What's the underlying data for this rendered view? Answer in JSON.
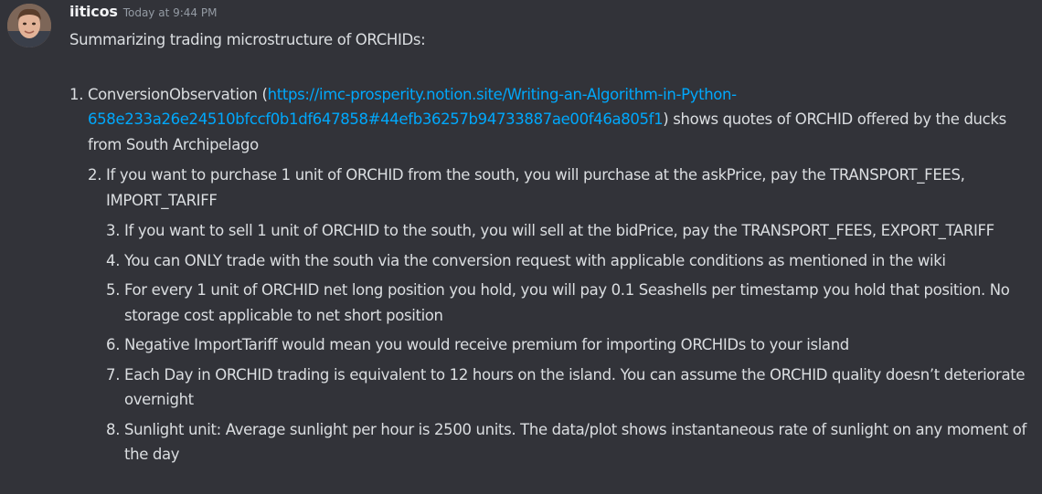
{
  "message": {
    "username": "iiticos",
    "timestamp": "Today at 9:44 PM",
    "intro": "Summarizing trading microstructure of ORCHIDs:",
    "item1": {
      "prefix": "ConversionObservation (",
      "link_line1": "https://imc-prosperity.notion.site/Writing-an-Algorithm-in-Python-",
      "link_line2": "658e233a26e24510bfccf0b1df647858#44efb36257b94733887ae00f46a805f1",
      "suffix": ") shows quotes of ORCHID offered by the ducks from South Archipelago"
    },
    "item2": "If you want to purchase 1 unit of ORCHID from the south, you will purchase at the askPrice, pay the TRANSPORT_FEES, IMPORT_TARIFF",
    "items": [
      "If you want to sell 1 unit of ORCHID to the south, you will sell at the bidPrice, pay the TRANSPORT_FEES, EXPORT_TARIFF",
      "You can ONLY trade with the south via the conversion request with applicable conditions as mentioned in the wiki",
      "For every 1 unit of ORCHID net long position you hold, you will pay 0.1 Seashells per timestamp you hold that position. No storage cost applicable to net short position",
      "Negative ImportTariff would mean you would receive premium for importing ORCHIDs to your island",
      "Each Day in ORCHID trading is equivalent to 12 hours on the island. You can assume the ORCHID quality doesn’t deteriorate overnight",
      "Sunlight unit: Average sunlight per hour is 2500 units. The data/plot shows instantaneous rate of sunlight on any moment of the day"
    ]
  }
}
